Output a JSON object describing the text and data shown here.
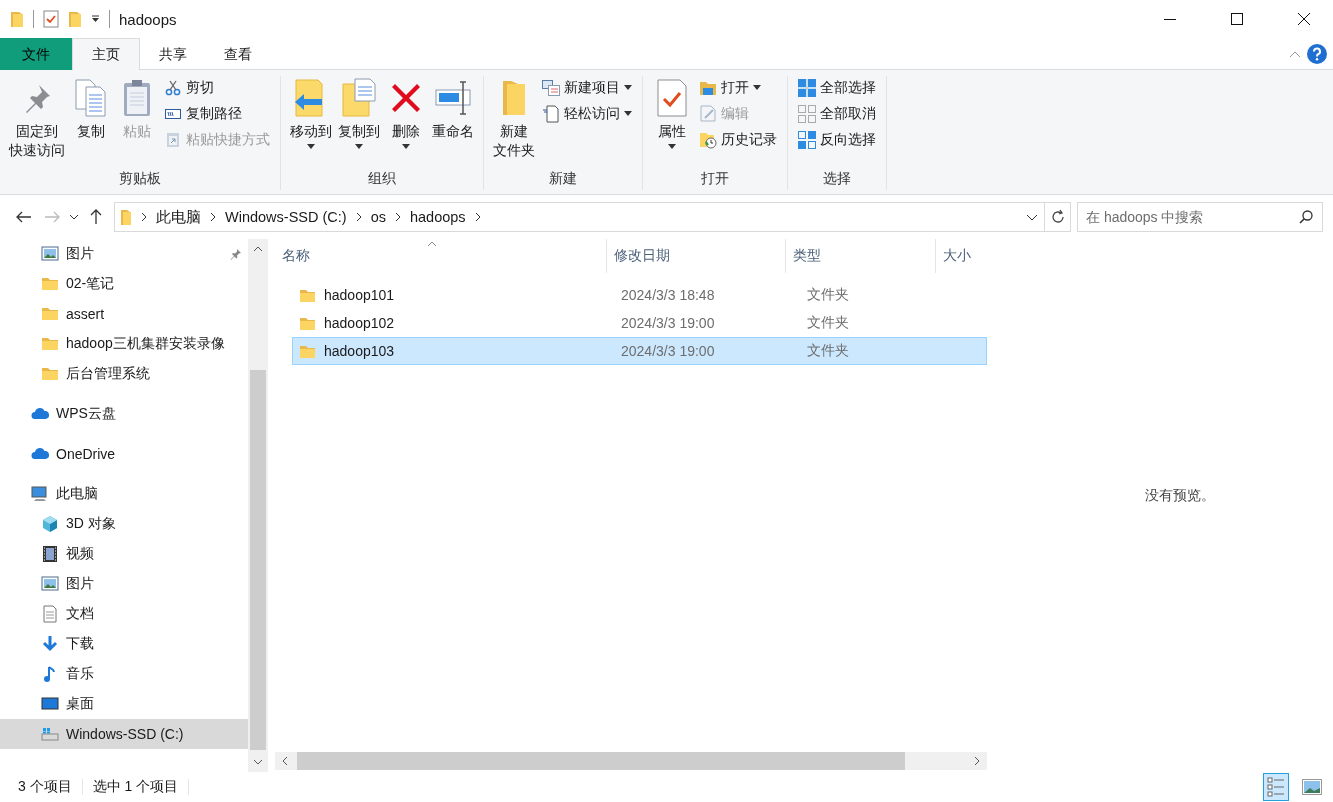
{
  "window": {
    "title": "hadoops"
  },
  "ribbon_tabs": [
    {
      "label": "文件",
      "kind": "file",
      "selected": false
    },
    {
      "label": "主页",
      "kind": "tab",
      "selected": true
    },
    {
      "label": "共享",
      "kind": "tab",
      "selected": false
    },
    {
      "label": "查看",
      "kind": "tab",
      "selected": false
    }
  ],
  "ribbon_groups": [
    {
      "label": "剪贴板",
      "items": [
        {
          "lines": [
            "固定到",
            "快速访问"
          ],
          "kind": "large",
          "disabled": false,
          "dropdown": false
        },
        {
          "label": "复制",
          "kind": "large",
          "disabled": false,
          "dropdown": false
        },
        {
          "label": "粘贴",
          "kind": "large",
          "disabled": true,
          "dropdown": false
        },
        {
          "label": "剪切",
          "kind": "small",
          "disabled": false,
          "dropdown": false
        },
        {
          "label": "复制路径",
          "kind": "small",
          "disabled": false,
          "dropdown": false
        },
        {
          "label": "粘贴快捷方式",
          "kind": "small",
          "disabled": true,
          "dropdown": false
        }
      ]
    },
    {
      "label": "组织",
      "items": [
        {
          "label": "移动到",
          "kind": "large",
          "disabled": false,
          "dropdown": true
        },
        {
          "label": "复制到",
          "kind": "large",
          "disabled": false,
          "dropdown": true
        },
        {
          "label": "删除",
          "kind": "large",
          "disabled": false,
          "dropdown": true
        },
        {
          "label": "重命名",
          "kind": "large",
          "disabled": false,
          "dropdown": false
        }
      ]
    },
    {
      "label": "新建",
      "items": [
        {
          "lines": [
            "新建",
            "文件夹"
          ],
          "kind": "large",
          "disabled": false,
          "dropdown": false
        },
        {
          "label": "新建项目",
          "kind": "small",
          "disabled": false,
          "dropdown": true
        },
        {
          "label": "轻松访问",
          "kind": "small",
          "disabled": false,
          "dropdown": true
        }
      ]
    },
    {
      "label": "打开",
      "items": [
        {
          "label": "属性",
          "kind": "large",
          "disabled": false,
          "dropdown": true
        },
        {
          "label": "打开",
          "kind": "small",
          "disabled": false,
          "dropdown": true
        },
        {
          "label": "编辑",
          "kind": "small",
          "disabled": true,
          "dropdown": false
        },
        {
          "label": "历史记录",
          "kind": "small",
          "disabled": false,
          "dropdown": false
        }
      ]
    },
    {
      "label": "选择",
      "items": [
        {
          "label": "全部选择",
          "kind": "small",
          "disabled": false,
          "dropdown": false
        },
        {
          "label": "全部取消",
          "kind": "small",
          "disabled": false,
          "dropdown": false
        },
        {
          "label": "反向选择",
          "kind": "small",
          "disabled": false,
          "dropdown": false
        }
      ]
    }
  ],
  "address_bar": {
    "breadcrumbs": [
      "此电脑",
      "Windows-SSD (C:)",
      "os",
      "hadoops"
    ]
  },
  "search": {
    "placeholder": "在 hadoops 中搜索"
  },
  "sidebar": {
    "quick_access_items": [
      {
        "label": "图片",
        "kind": "pictures",
        "pinned": true,
        "selected": false
      },
      {
        "label": "02-笔记",
        "kind": "folder",
        "pinned": false,
        "selected": false
      },
      {
        "label": "assert",
        "kind": "folder",
        "pinned": false,
        "selected": false
      },
      {
        "label": "hadoop三机集群安装录像",
        "kind": "folder",
        "pinned": false,
        "selected": false
      },
      {
        "label": "后台管理系统",
        "kind": "folder",
        "pinned": false,
        "selected": false
      }
    ],
    "items": [
      {
        "label": "WPS云盘",
        "kind": "cloud",
        "selected": false
      },
      {
        "label": "OneDrive",
        "kind": "cloud",
        "selected": false
      },
      {
        "label": "此电脑",
        "kind": "pc",
        "selected": false,
        "children": [
          {
            "label": "3D 对象",
            "kind": "cube",
            "selected": false
          },
          {
            "label": "视频",
            "kind": "video",
            "selected": false
          },
          {
            "label": "图片",
            "kind": "pictures",
            "selected": false
          },
          {
            "label": "文档",
            "kind": "document",
            "selected": false
          },
          {
            "label": "下载",
            "kind": "download",
            "selected": false
          },
          {
            "label": "音乐",
            "kind": "music",
            "selected": false
          },
          {
            "label": "桌面",
            "kind": "desktop",
            "selected": false
          },
          {
            "label": "Windows-SSD (C:)",
            "kind": "drive",
            "selected": true
          }
        ]
      }
    ]
  },
  "file_list": {
    "columns": [
      "名称",
      "修改日期",
      "类型",
      "大小"
    ],
    "rows": [
      {
        "name": "hadoop101",
        "modified": "2024/3/3 18:48",
        "type": "文件夹",
        "selected": false
      },
      {
        "name": "hadoop102",
        "modified": "2024/3/3 19:00",
        "type": "文件夹",
        "selected": false
      },
      {
        "name": "hadoop103",
        "modified": "2024/3/3 19:00",
        "type": "文件夹",
        "selected": true
      }
    ]
  },
  "preview": {
    "message": "没有预览。"
  },
  "status_bar": {
    "item_count": "3 个项目",
    "selection": "选中 1 个项目",
    "views": [
      {
        "kind": "details",
        "selected": true
      },
      {
        "kind": "large_icons",
        "selected": false
      }
    ]
  }
}
